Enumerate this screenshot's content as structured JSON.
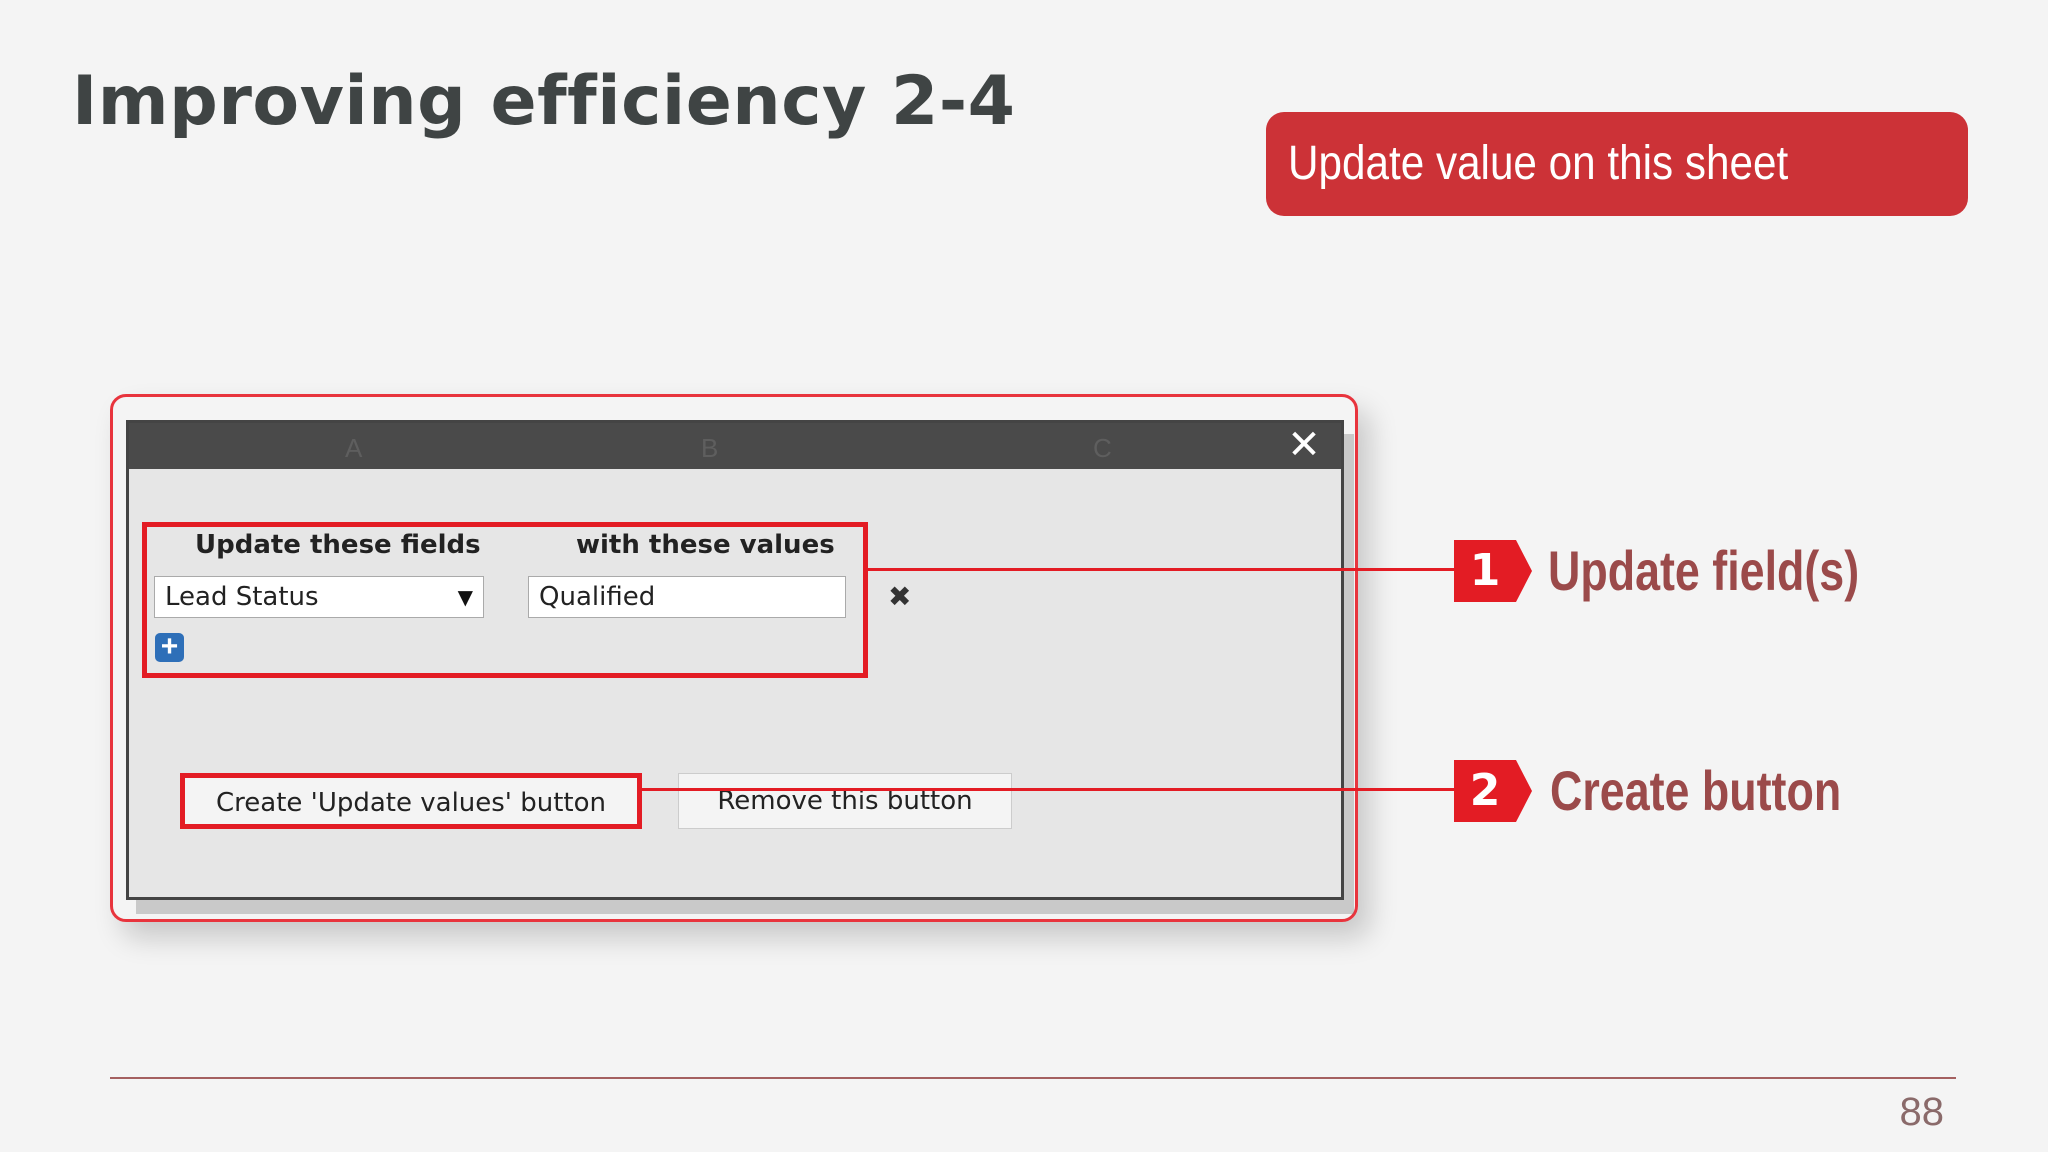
{
  "slide": {
    "title": "Improving efficiency 2-4",
    "banner": "Update value on this sheet",
    "page_number": "88"
  },
  "dialog": {
    "column_letters": [
      "A",
      "B",
      "C"
    ],
    "close_glyph": "✕",
    "headers": {
      "fields": "Update these fields",
      "values": "with these values"
    },
    "field_select": {
      "selected": "Lead Status"
    },
    "value_input": {
      "value": "Qualified"
    },
    "remove_row_glyph": "✖",
    "add_row_glyph": "+",
    "buttons": {
      "create": "Create 'Update values' button",
      "remove": "Remove this button"
    }
  },
  "annotations": [
    {
      "number": "1",
      "label": "Update field(s)"
    },
    {
      "number": "2",
      "label": "Create button"
    }
  ],
  "colors": {
    "accent": "#e31c24",
    "banner": "#cc3237",
    "label": "#9b4a4a"
  },
  "icons": {
    "close": "close-icon",
    "remove_row": "remove-row-icon",
    "add_row": "add-row-icon",
    "select_arrow": "triangle-down-icon"
  }
}
